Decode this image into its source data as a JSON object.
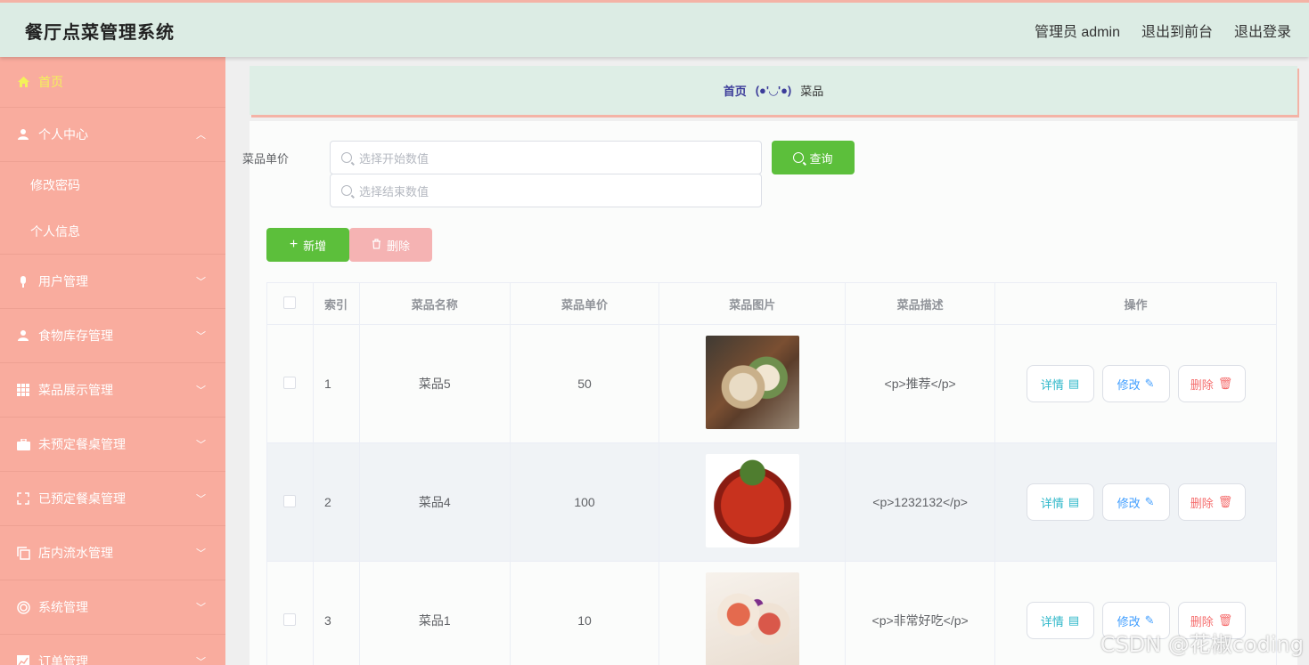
{
  "header": {
    "title": "餐厅点菜管理系统",
    "user_label": "管理员 admin",
    "to_frontend": "退出到前台",
    "logout": "退出登录"
  },
  "sidebar": {
    "home": "首页",
    "personal_center": "个人中心",
    "change_password": "修改密码",
    "personal_info": "个人信息",
    "items": [
      "用户管理",
      "食物库存管理",
      "菜品展示管理",
      "未预定餐桌管理",
      "已预定餐桌管理",
      "店内流水管理",
      "系统管理",
      "订单管理"
    ]
  },
  "breadcrumb": {
    "home": "首页",
    "separator": "(●'◡'●)",
    "current": "菜品"
  },
  "search": {
    "label": "菜品单价",
    "start_placeholder": "选择开始数值",
    "end_placeholder": "选择结束数值",
    "query_button": "查询"
  },
  "actions": {
    "add": "新增",
    "delete": "删除"
  },
  "table": {
    "headers": [
      "索引",
      "菜品名称",
      "菜品单价",
      "菜品图片",
      "菜品描述",
      "操作"
    ],
    "rows": [
      {
        "index": "1",
        "name": "菜品5",
        "price": "50",
        "desc": "<p>推荐</p>"
      },
      {
        "index": "2",
        "name": "菜品4",
        "price": "100",
        "desc": "<p>1232132</p>"
      },
      {
        "index": "3",
        "name": "菜品1",
        "price": "10",
        "desc": "<p>非常好吃</p>"
      }
    ],
    "ops": {
      "view": "详情",
      "edit": "修改",
      "remove": "删除"
    }
  },
  "watermark": "CSDN @花椒coding",
  "colors": {
    "header_bg": "#dcece4",
    "sidebar_bg": "#f9ac9e",
    "home_highlight": "#f3f25a",
    "green_button": "#5cbf3b",
    "delete_button": "#f5b3b3"
  }
}
